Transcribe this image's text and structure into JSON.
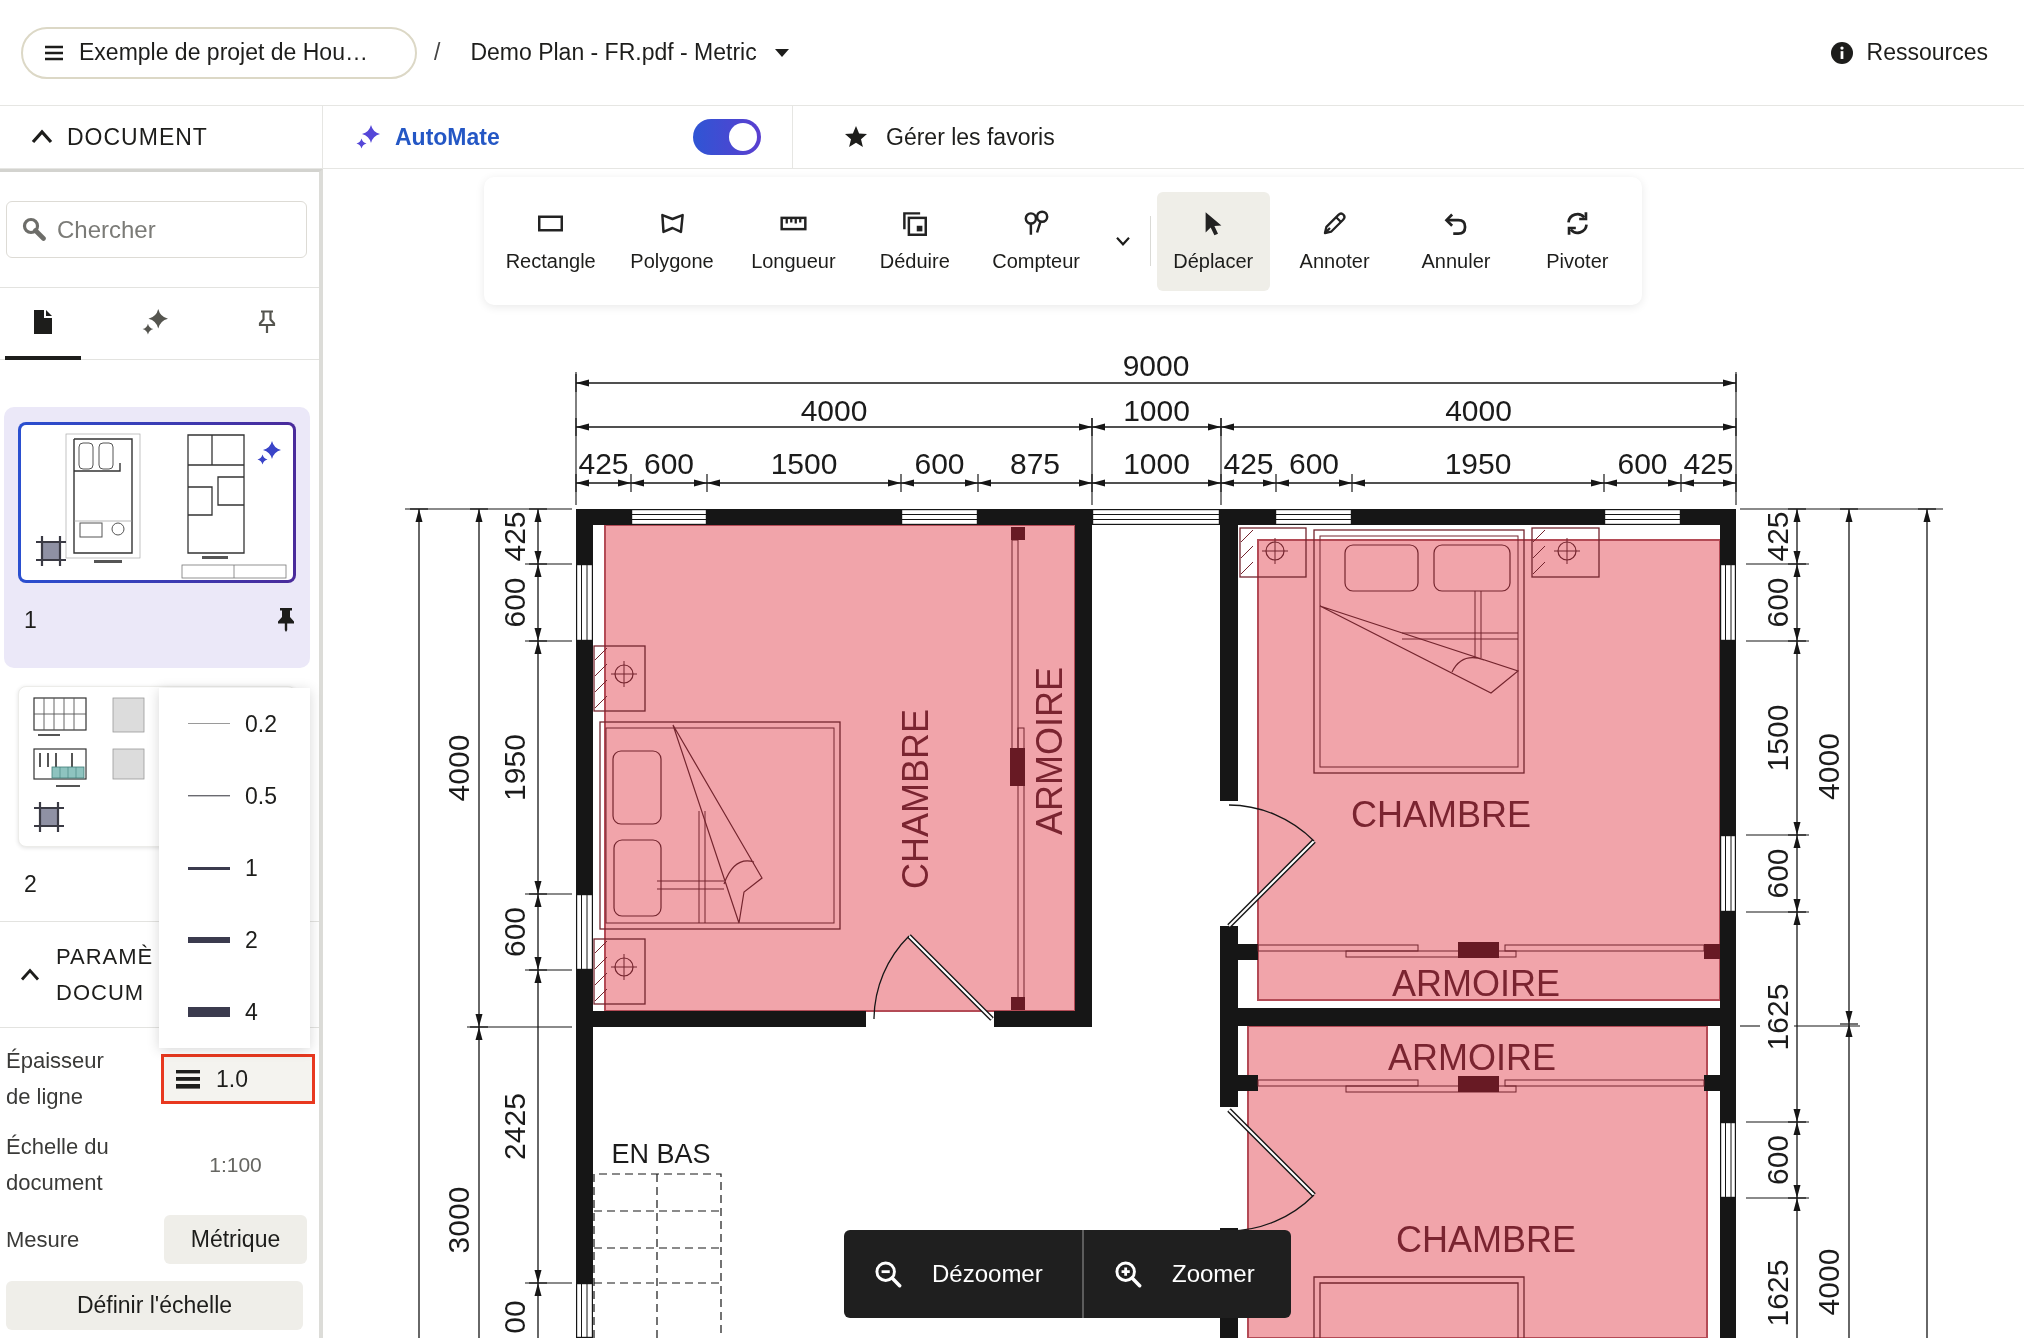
{
  "header": {
    "project": {
      "label": "Exemple de projet de Hou…"
    },
    "separator": "/",
    "document": {
      "label": "Demo Plan - FR.pdf - Metric"
    },
    "resources": {
      "label": "Ressources"
    }
  },
  "subbar": {
    "panel": {
      "label": "DOCUMENT",
      "expanded": true
    },
    "automate": {
      "label": "AutoMate",
      "on": true
    },
    "favorites": {
      "label": "Gérer les favoris"
    }
  },
  "sidebar": {
    "search": {
      "placeholder": "Chercher"
    },
    "tabs": [
      {
        "kind": "pages",
        "selected": true
      },
      {
        "kind": "automate",
        "selected": false
      },
      {
        "kind": "pinned",
        "selected": false
      }
    ],
    "pages": [
      {
        "number": "1",
        "kind": "floor_plans",
        "selected": true,
        "automate": true,
        "pinned": true
      },
      {
        "number": "2",
        "kind": "elevations",
        "selected": false
      }
    ],
    "settings": {
      "heading": "PARAMÈ DOCUM",
      "expanded": true,
      "line_width": {
        "label": "Épaisseur de ligne",
        "value": "1.0",
        "highlighted": true,
        "open": true,
        "options": [
          {
            "label": "0.2",
            "kind": "hairline"
          },
          {
            "label": "0.5",
            "kind": "thin"
          },
          {
            "label": "1",
            "kind": "medium"
          },
          {
            "label": "2",
            "kind": "thick"
          },
          {
            "label": "4",
            "kind": "heavy"
          }
        ]
      },
      "scale": {
        "label": "Échelle du document",
        "value": "1:100"
      },
      "measure": {
        "label": "Mesure",
        "value": "Métrique"
      },
      "action": "Définir l'échelle"
    }
  },
  "toolbar": {
    "measure_tools": [
      {
        "kind": "rectangle",
        "label": "Rectangle",
        "selected": false
      },
      {
        "kind": "polygon",
        "label": "Polygone",
        "selected": false
      },
      {
        "kind": "length",
        "label": "Longueur",
        "selected": false
      },
      {
        "kind": "deduct",
        "label": "Déduire",
        "selected": false
      },
      {
        "kind": "counter",
        "label": "Compteur",
        "selected": false
      }
    ],
    "edit_tools": [
      {
        "kind": "move",
        "label": "Déplacer",
        "selected": true
      },
      {
        "kind": "annotate",
        "label": "Annoter",
        "selected": false
      },
      {
        "kind": "undo",
        "label": "Annuler",
        "selected": false
      },
      {
        "kind": "rotate",
        "label": "Pivoter",
        "selected": false
      }
    ]
  },
  "plan": {
    "top_dimensions": [
      [
        "9000"
      ],
      [
        "4000",
        "1000",
        "4000"
      ],
      [
        "425",
        "600",
        "1500",
        "600",
        "875",
        "1000",
        "425",
        "600",
        "1950",
        "600",
        "425"
      ]
    ],
    "left_dimensions": [
      [
        "4000",
        "3000"
      ],
      [
        "425",
        "600",
        "1950",
        "600",
        "2425",
        "00"
      ]
    ],
    "right_dimensions": [
      [
        "425",
        "600",
        "1500",
        "600",
        "1625",
        "600",
        "1625"
      ],
      [
        "4000",
        "4000"
      ]
    ],
    "room_labels": [
      "CHAMBRE",
      "ARMOIRE",
      "CHAMBRE",
      "ARMOIRE",
      "ARMOIRE",
      "CHAMBRE"
    ],
    "stairs": {
      "label": "EN BAS"
    }
  },
  "zoom_controls": [
    {
      "kind": "zoom_out",
      "label": "Dézoomer"
    },
    {
      "kind": "zoom_in",
      "label": "Zoomer"
    }
  ]
}
